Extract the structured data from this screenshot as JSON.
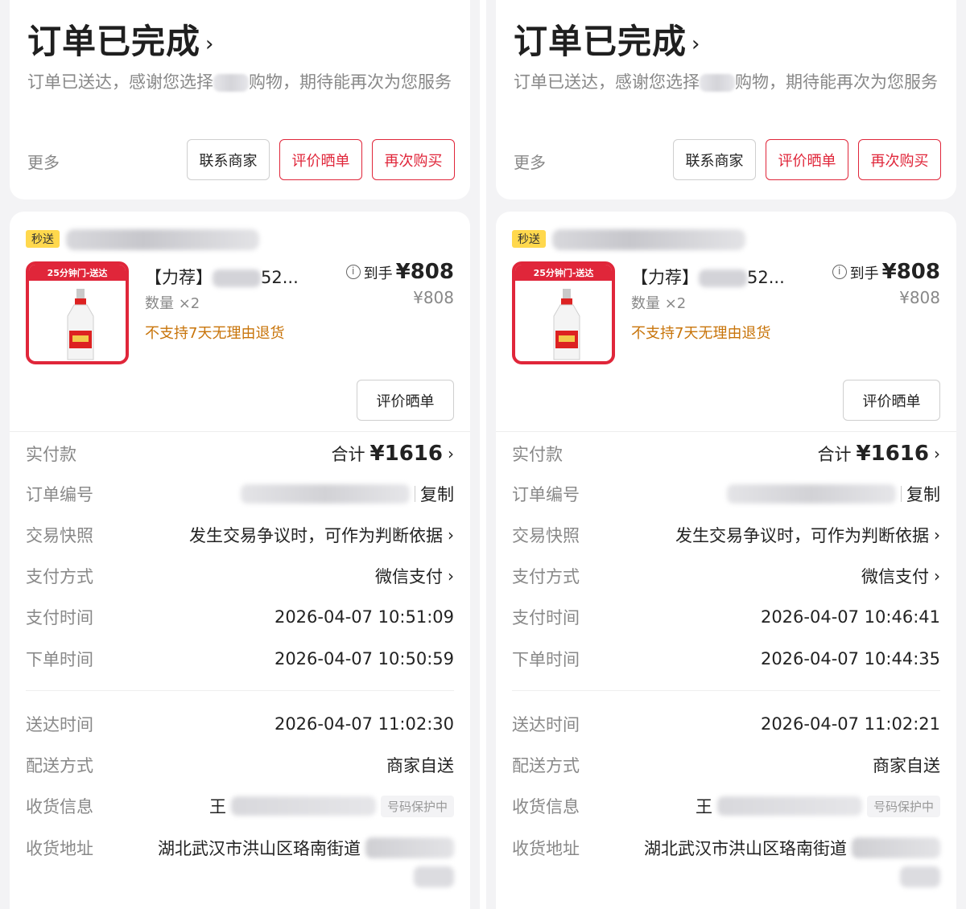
{
  "panels": [
    {
      "status": {
        "title": "订单已完成",
        "desc_prefix": "订单已送达，感谢您选择",
        "desc_suffix": "购物，期待能再次为您服务"
      },
      "actions": {
        "more": "更多",
        "contact": "联系商家",
        "review": "评价晒单",
        "rebuy": "再次购买"
      },
      "order": {
        "tag": "秒送",
        "product_badge": "25分钟门-送达",
        "product_name_prefix": "【力荐】",
        "product_name_suffix": "52...",
        "quantity": "数量 ×2",
        "return_policy": "不支持7天无理由退货",
        "paid_label": "到手",
        "paid_amount": "¥808",
        "unit_price": "¥808",
        "review_button": "评价晒单"
      },
      "details": {
        "total": {
          "label": "实付款",
          "prefix": "合计",
          "amount": "¥1616"
        },
        "order_no": {
          "label": "订单编号",
          "action": "复制"
        },
        "snapshot": {
          "label": "交易快照",
          "value": "发生交易争议时，可作为判断依据"
        },
        "pay_method": {
          "label": "支付方式",
          "value": "微信支付"
        },
        "pay_time": {
          "label": "支付时间",
          "value": "2026-04-07 10:51:09"
        },
        "order_time": {
          "label": "下单时间",
          "value": "2026-04-07 10:50:59"
        },
        "delivery_time": {
          "label": "送达时间",
          "value": "2026-04-07 11:02:30"
        },
        "ship_method": {
          "label": "配送方式",
          "value": "商家自送"
        },
        "receiver": {
          "label": "收货信息",
          "name": "王",
          "protect": "号码保护中"
        },
        "address": {
          "label": "收货地址",
          "value": "湖北武汉市洪山区珞南街道"
        }
      }
    },
    {
      "status": {
        "title": "订单已完成",
        "desc_prefix": "订单已送达，感谢您选择",
        "desc_suffix": "购物，期待能再次为您服务"
      },
      "actions": {
        "more": "更多",
        "contact": "联系商家",
        "review": "评价晒单",
        "rebuy": "再次购买"
      },
      "order": {
        "tag": "秒送",
        "product_badge": "25分钟门-送达",
        "product_name_prefix": "【力荐】",
        "product_name_suffix": "52...",
        "quantity": "数量 ×2",
        "return_policy": "不支持7天无理由退货",
        "paid_label": "到手",
        "paid_amount": "¥808",
        "unit_price": "¥808",
        "review_button": "评价晒单"
      },
      "details": {
        "total": {
          "label": "实付款",
          "prefix": "合计",
          "amount": "¥1616"
        },
        "order_no": {
          "label": "订单编号",
          "action": "复制"
        },
        "snapshot": {
          "label": "交易快照",
          "value": "发生交易争议时，可作为判断依据"
        },
        "pay_method": {
          "label": "支付方式",
          "value": "微信支付"
        },
        "pay_time": {
          "label": "支付时间",
          "value": "2026-04-07 10:46:41"
        },
        "order_time": {
          "label": "下单时间",
          "value": "2026-04-07 10:44:35"
        },
        "delivery_time": {
          "label": "送达时间",
          "value": "2026-04-07 11:02:21"
        },
        "ship_method": {
          "label": "配送方式",
          "value": "商家自送"
        },
        "receiver": {
          "label": "收货信息",
          "name": "王",
          "protect": "号码保护中"
        },
        "address": {
          "label": "收货地址",
          "value": "湖北武汉市洪山区珞南街道"
        }
      }
    }
  ],
  "icons": {
    "chevron": "chevron-right-icon",
    "info": "info-circle-icon"
  },
  "colors": {
    "accent_red": "#e0263a",
    "warning_orange": "#c8740a",
    "tag_yellow": "#ffd84d"
  }
}
